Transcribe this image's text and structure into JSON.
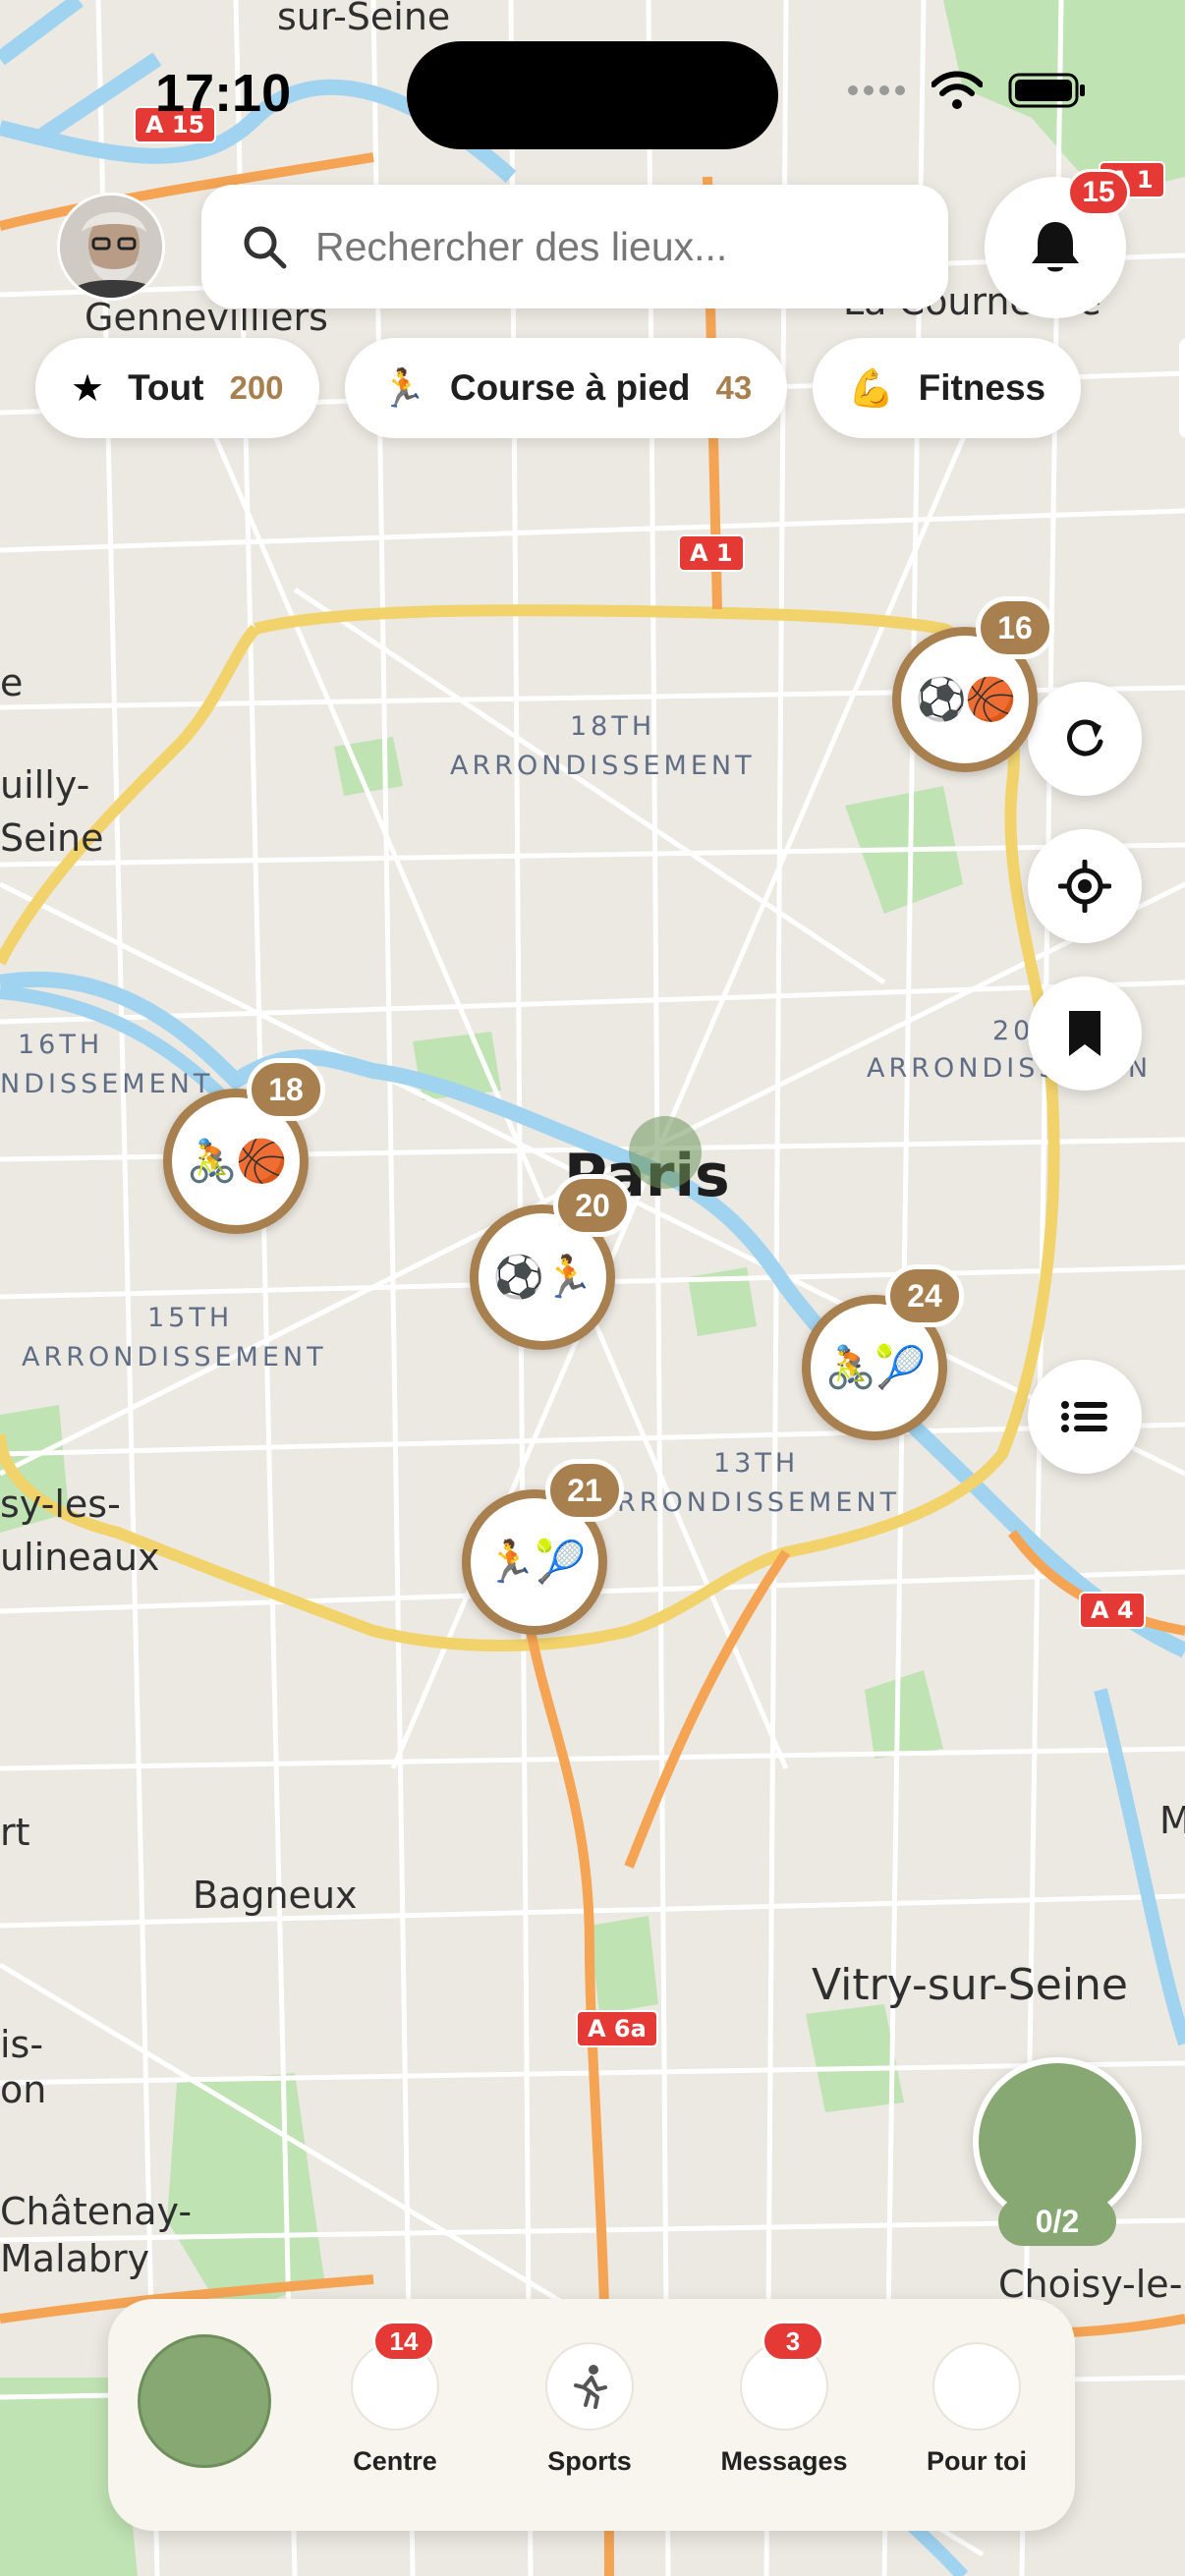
{
  "status_bar": {
    "time": "17:10"
  },
  "map": {
    "labels": {
      "top_city": "sur-Seine",
      "gennevilliers": "Gennevilliers",
      "top_right_city": "La Courneuve",
      "left_city_a": "uilly-",
      "left_city_b": "Seine",
      "arr18_a": "18TH",
      "arr18_b": "ARRONDISSEMENT",
      "arr16_a": "16TH",
      "arr16_b": "NDISSEMENT",
      "arr20_a": "20",
      "arr20_b": "ARRONDISSEMEN",
      "paris": "Paris",
      "arr15_a": "15TH",
      "arr15_b": "ARRONDISSEMENT",
      "arr13_a": "13TH",
      "arr13_b": "RRONDISSEMENT",
      "issy_a": "sy-les-",
      "issy_b": "ulineaux",
      "bagneux": "Bagneux",
      "vitry": "Vitry-sur-Seine",
      "chatenay_a": "Châtenay-",
      "chatenay_b": "Malabry",
      "choisy": "Choisy-le-",
      "left_edge_rt": "rt",
      "left_edge_is": "is-",
      "left_edge_on": "on",
      "right_edge_m": "M",
      "left_edge_e": "e"
    },
    "road_shields": {
      "a15": "A 15",
      "a1_top": "A 1",
      "a1": "A 1",
      "a4": "A 4",
      "a6a": "A 6a"
    }
  },
  "header": {
    "search_placeholder": "Rechercher des lieux...",
    "notification_count": "15"
  },
  "filters": [
    {
      "icon": "star-icon",
      "label": "Tout",
      "count": "200"
    },
    {
      "icon": "🏃",
      "label": "Course à pied",
      "count": "43"
    },
    {
      "icon": "💪",
      "label": "Fitness",
      "count": ""
    }
  ],
  "markers": [
    {
      "emoji": "⚽🏀",
      "count": "16"
    },
    {
      "emoji": "🚴🏀",
      "count": "18"
    },
    {
      "emoji": "⚽🏃",
      "count": "20"
    },
    {
      "emoji": "🚴🎾",
      "count": "24"
    },
    {
      "emoji": "🏃🎾",
      "count": "21"
    }
  ],
  "progress": {
    "label": "0/2"
  },
  "bottom_nav": {
    "items": [
      {
        "label": "Centre",
        "badge": "14"
      },
      {
        "label": "Sports",
        "badge": ""
      },
      {
        "label": "Messages",
        "badge": "3"
      },
      {
        "label": "Pour toi",
        "badge": ""
      }
    ]
  },
  "colors": {
    "accent_brown": "#a87f4f",
    "accent_green": "#87a873",
    "badge_red": "#e53935",
    "map_background": "#ece8e2",
    "water": "#9fd3f0",
    "park": "#bfe3b2",
    "highway": "#f5a454",
    "ring_road": "#f2d36b"
  }
}
